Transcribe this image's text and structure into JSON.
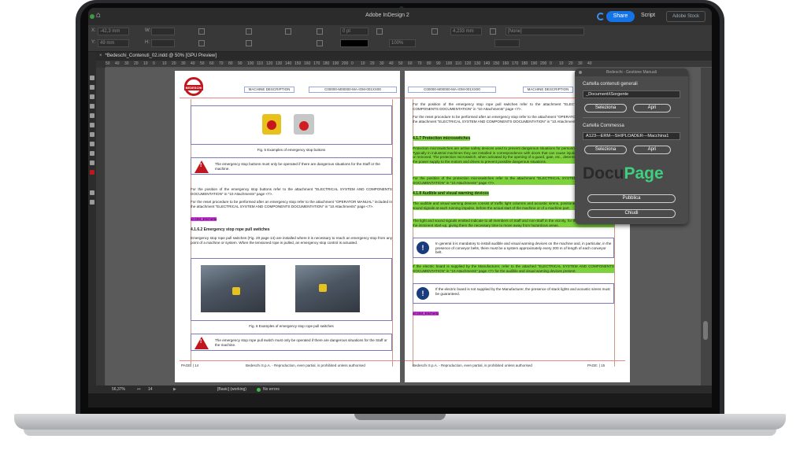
{
  "app": {
    "window_title": "Adobe InDesign 2",
    "share_label": "Share",
    "script_label": "Script",
    "stock_label": "Adobe Stock"
  },
  "control_bar": {
    "x_label": "X:",
    "x_value": "-42,3 mm",
    "y_label": "Y:",
    "y_value": "49 mm",
    "w_label": "W:",
    "h_label": "H:",
    "stroke_pt": "0 pt",
    "zoom_pct": "100%",
    "width_mm": "4,233 mm",
    "style_value": "[None]"
  },
  "document_tab": {
    "label": "*Bedeschi_Contenuti_02.indd @ 50% [GPU Preview]"
  },
  "ruler": {
    "ticks": [
      "50",
      "40",
      "30",
      "20",
      "10",
      "0",
      "10",
      "20",
      "30",
      "40",
      "50",
      "60",
      "70",
      "80",
      "90",
      "100",
      "110",
      "120",
      "130",
      "140",
      "150",
      "160",
      "170",
      "180",
      "190",
      "200",
      "0",
      "10",
      "20",
      "30",
      "40",
      "50",
      "60",
      "70",
      "80",
      "90",
      "100",
      "110",
      "120",
      "130",
      "140",
      "150",
      "160",
      "170",
      "180",
      "190",
      "200",
      "0",
      "10",
      "20",
      "30",
      "40"
    ]
  },
  "left_page": {
    "logo_text": "BEDESCHI",
    "header_title": "MACHINE DESCRIPTION",
    "header_code": "C00000-M00000-MA-IOM-001XX00",
    "fig5_caption": "Fig. 5 Examples of emergency stop buttons",
    "warn1": "The emergency stop buttons must only be operated if there are dangerous situations for the Staff or the machine.",
    "para1": "For the position of the emergency stop buttons refer to the attachment \"ELECTRICAL SYSTEM AND COMPONENTS DOCUMENTATION\" in \"10 Attachments\" page <7>.",
    "para2": "For the reset procedure to be performed after an emergency stop refer to the attachment \"OPERATOR MANUAL\" included in the attachment \"ELECTRICAL SYSTEM AND COMPONENTS DOCUMENTATION\" in \"10 Attachments\" page <7>.",
    "tag1": "xCOM_Etichetta",
    "section": "4.1.6.2    Emergency stop rope pull switches",
    "para3": "Emergency stop rope pull switches (Fig. 20 page 14) are installed where it is necessary to reach an emergency stop from any point of a machine or system. When the tensioned rope is pulled, an emergency stop control is actuated.",
    "fig6_caption": "Fig. 6 Examples of emergency stop rope pull switches",
    "warn2": "The emergency stop rope pull switch must only be operated if there are dangerous situations for the Staff or the machine.",
    "footer_page": "PAGE: | 14",
    "footer_text": "Bedeschi S.p.A. - Reproduction, even partial, is prohibited unless authorised"
  },
  "right_page": {
    "header_code": "C00000-M00000-MA-IOM-001XX00",
    "header_title": "MACHINE DESCRIPTION",
    "para1": "For the position of the emergency stop rope pull switches refer to the attachment \"ELECTRICAL SYSTEM AND COMPONENTS DOCUMENTATION\" in \"10 Attachments\" page <7>.",
    "para2": "For the reset procedure to be performed after an emergency stop refer to the attachment \"OPERATOR MANUAL\" included in the attachment \"ELECTRICAL SYSTEM AND COMPONENTS DOCUMENTATION\" in \"10 Attachments\" page <7>.",
    "section1": "4.1.7    Protection microswitches",
    "para3": "Protection microswitches are active safety devices used to prevent dangerous situations for personnel in case of emergency. Typically in industrial machines they are installed in correspondence with doors that can cause injuries to the Staff, if opened or removed. The protection microswitch, when activated by the opening of a guard, gate, etc., determines the disconnection of the power supply to the motors and drives to prevent possible dangerous situations.",
    "para4": "For the position of the protection microswitches refer to the attachment \"ELECTRICAL SYSTEM AND COMPONENTS DOCUMENTATION\" in \"10 Attachments\" page <7>.",
    "section2": "4.1.8    Audible and visual warning devices",
    "para5": "The audible and visual warning devices consist of traffic light columns and acoustic sirens, positioned, respectively, light and sound signals at each running impulse, before the actual start of the machine or of a machine part.",
    "para6": "The light and sound signals emitted indicate to all members of Staff and non-Staff in the vicinity, for the security of the system the imminent start-up, giving them the necessary time to move away from hazardous areas.",
    "info1": "In general it is mandatory to install audible and visual warning devices on the machine and, in particular, in the presence of conveyor belts, there must be a system approximately every 200 m of length of each conveyor belt.",
    "para7": "If the electric board is supplied by the Manufacturer, refer to the attached \"ELECTRICAL SYSTEM AND COMPONENTS DOCUMENTATION\" in \"10 Attachments\" page <7> for the audible and visual warning devices present.",
    "info2": "If the electric board is not supplied by the Manufacturer, the presence of stack lights and acoustic sirens must be guaranteed.",
    "tag1": "xCOM_Etichetta",
    "footer_text": "Bedeschi S.p.A. - Reproduction, even partial, is prohibited unless authorised",
    "footer_page": "PAGE: | 15"
  },
  "panel": {
    "title": "Bedeschi - Gestione Manuali",
    "group1_label": "Cartella contenuti generali",
    "group1_value": "_Documenti\\Sorgente",
    "select1": "Seleziona",
    "open1": "Apri",
    "group2_label": "Cartella Commessa",
    "group2_value": "A123---ERM---SHIPLOADER---Macchina1",
    "select2": "Seleziona",
    "open2": "Apri",
    "logo_part1": "Docu",
    "logo_part2": "Page",
    "publish": "Pubblica",
    "close": "Chiudi"
  },
  "status_bar": {
    "zoom": "56,37%",
    "page": "14",
    "style": "[Basic] (working)",
    "errors": "No errors"
  },
  "colors": {
    "accent_blue": "#1473e6",
    "highlight_green": "#7ed33c",
    "highlight_magenta": "#d13be3",
    "brand_red": "#c0161d",
    "docupage_green": "#3fd07e"
  }
}
